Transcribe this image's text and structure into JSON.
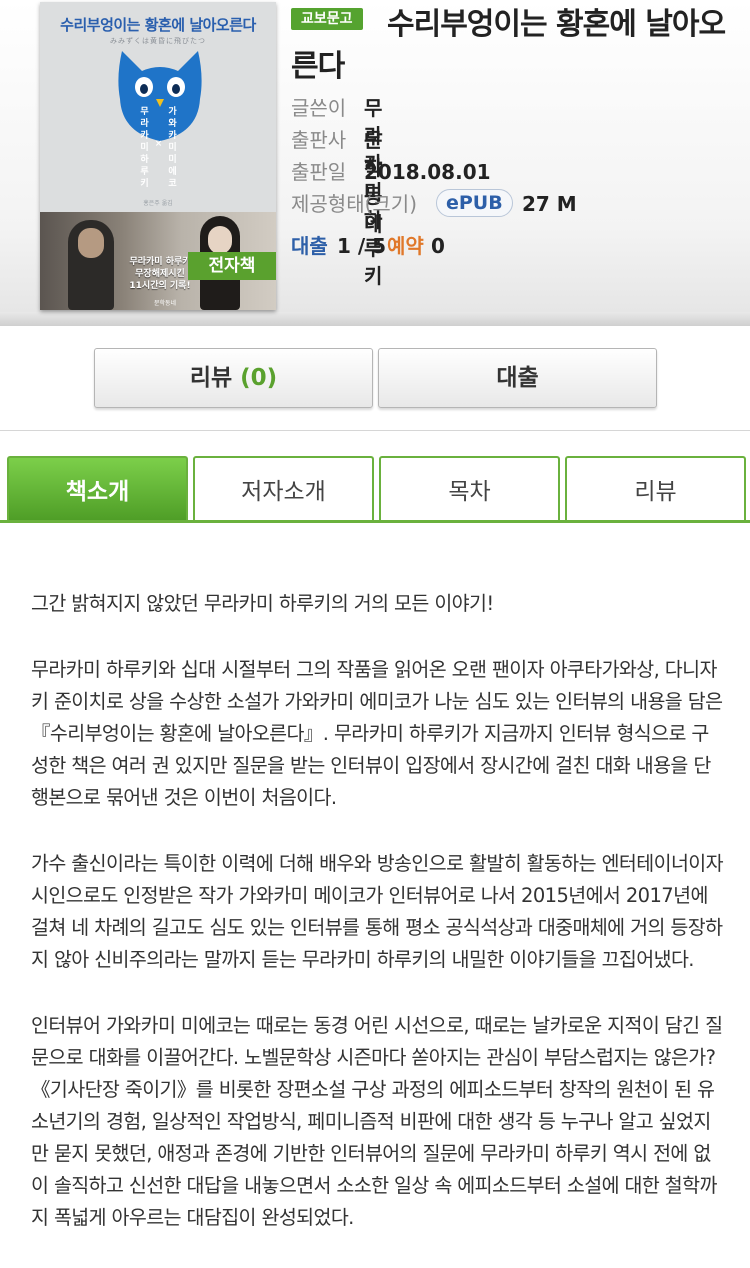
{
  "book": {
    "store_badge": "교보문고",
    "title": "수리부엉이는 황혼에 날아오른다",
    "ebook_badge": "전자책",
    "cover": {
      "title": "수리부엉이는 황혼에 날아오른다",
      "subtitle": "みみずくは黄昏に飛びたつ",
      "vertical_left": [
        "무",
        "라",
        "카",
        "미",
        "",
        "하",
        "루",
        "키"
      ],
      "vertical_right": [
        "가",
        "와",
        "카",
        "미",
        "",
        "미",
        "에",
        "코"
      ],
      "times": "×",
      "small_pub": "홍은주 옮김",
      "photo_text": "무라카미 하루키\n무장해제시킨\n11시간의 기록!",
      "logo": "문학동네"
    },
    "author_label": "글쓴이",
    "author": "무라카미 하루키",
    "publisher_label": "출판사",
    "publisher": "문학동네",
    "date_label": "출판일",
    "date": "2018.08.01",
    "format_label": "제공형태(크기)",
    "format": "ePUB",
    "size": "27 M",
    "loan_label": "대출",
    "loan_value": "1 / 5",
    "reserve_label": "예약",
    "reserve_value": "0"
  },
  "buttons": {
    "review_label": "리뷰",
    "review_count": "(0)",
    "loan_label": "대출"
  },
  "tabs": [
    {
      "label": "책소개",
      "active": true
    },
    {
      "label": "저자소개",
      "active": false
    },
    {
      "label": "목차",
      "active": false
    },
    {
      "label": "리뷰",
      "active": false
    }
  ],
  "description": [
    "그간 밝혀지지 않았던 무라카미 하루키의 거의 모든 이야기!",
    "무라카미 하루키와 십대 시절부터 그의 작품을 읽어온 오랜 팬이자 아쿠타가와상, 다니자키 준이치로 상을 수상한 소설가 가와카미 에미코가 나눈 심도 있는 인터뷰의 내용을 담은『수리부엉이는 황혼에 날아오른다』. 무라카미 하루키가 지금까지 인터뷰 형식으로 구성한 책은 여러 권 있지만 질문을 받는 인터뷰이 입장에서 장시간에 걸친 대화 내용을 단행본으로 묶어낸 것은 이번이 처음이다.",
    "가수 출신이라는 특이한 이력에 더해 배우와 방송인으로 활발히 활동하는 엔터테이너이자 시인으로도 인정받은 작가 가와카미 메이코가 인터뷰어로 나서 2015년에서 2017년에 걸쳐 네 차례의 길고도 심도 있는 인터뷰를 통해 평소 공식석상과 대중매체에 거의 등장하지 않아 신비주의라는 말까지 듣는 무라카미 하루키의 내밀한 이야기들을 끄집어냈다.",
    "인터뷰어 가와카미 미에코는 때로는 동경 어린 시선으로, 때로는 날카로운 지적이 담긴 질문으로 대화를 이끌어간다. 노벨문학상 시즌마다 쏟아지는 관심이 부담스럽지는 않은가?《기사단장 죽이기》를 비롯한 장편소설 구상 과정의 에피소드부터 창작의 원천이 된 유소년기의 경험, 일상적인 작업방식, 페미니즘적 비판에 대한 생각 등 누구나 알고 싶었지만 묻지 못했던, 애정과 존경에 기반한 인터뷰어의 질문에 무라카미 하루키 역시 전에 없이 솔직하고 신선한 대답을 내놓으면서 소소한 일상 속 에피소드부터 소설에 대한 철학까지 폭넓게 아우르는 대담집이 완성되었다."
  ]
}
